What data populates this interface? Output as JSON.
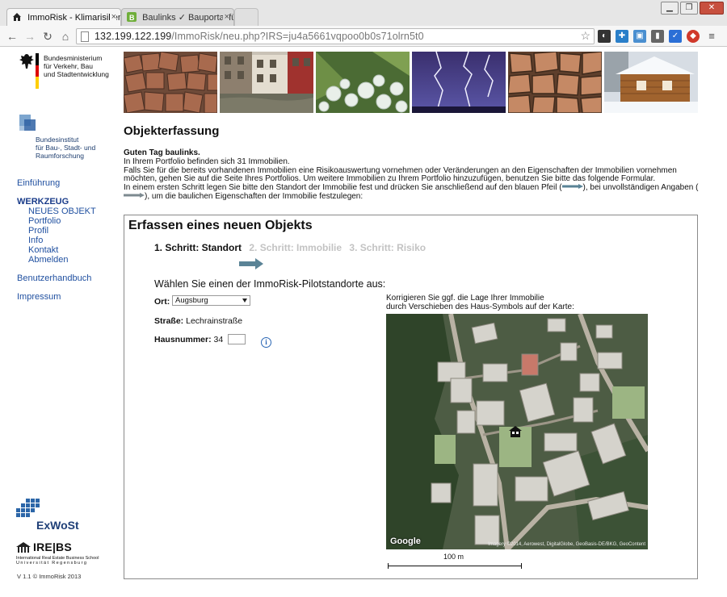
{
  "browser": {
    "tabs": [
      {
        "label": "ImmoRisk - Klimarisiken",
        "close": "×"
      },
      {
        "label": "Baulinks ✓ Bauportal für",
        "close": "×"
      }
    ],
    "url_host": "132.199.122.199",
    "url_path": "/ImmoRisk/neu.php?IRS=ju4a5661vqpoo0b0s71olrn5t0",
    "window_buttons": [
      "▁",
      "❐",
      "✕"
    ]
  },
  "sidebar": {
    "ministry": [
      "Bundesministerium",
      "für Verkehr, Bau",
      "und Stadtentwicklung"
    ],
    "institute": [
      "Bundesinstitut",
      "für Bau-, Stadt- und",
      "Raumforschung"
    ],
    "nav": {
      "einfuehrung": "Einführung",
      "werkzeug": "WERKZEUG",
      "werkzeug_items": [
        "NEUES OBJEKT",
        "Portfolio",
        "Profil",
        "Info",
        "Kontakt",
        "Abmelden"
      ],
      "benutzerhandbuch": "Benutzerhandbuch",
      "impressum": "Impressum"
    },
    "exwost": "ExWoSt",
    "irebs": "IRE|BS",
    "irebs_sub1": "International Real Estate Business School",
    "irebs_sub2": "Universität Regensburg",
    "version": "V 1.1 © ImmoRisk 2013"
  },
  "main": {
    "title": "Objekterfassung",
    "greeting": "Guten Tag baulinks.",
    "intro_lines": [
      "In Ihrem Portfolio befinden sich 31 Immobilien.",
      "Falls Sie für die bereits vorhandenen Immobilien eine Risikoauswertung vornehmen oder Veränderungen an den Eigenschaften der Immobilien vornehmen möchten, gehen Sie auf die Seite Ihres Portfolios. Um weitere Immobilien zu Ihrem Portfolio hinzuzufügen, benutzen Sie bitte das folgende Formular."
    ],
    "intro_step_part1": "In einem ersten Schritt legen Sie bitte den Standort der Immobilie fest und drücken Sie anschließend auf den blauen Pfeil (",
    "intro_step_part2": "), bei unvollständigen Angaben (",
    "intro_step_part3": "), um die baulichen Eigenschaften der Immobilie festzulegen:"
  },
  "form": {
    "title": "Erfassen eines neuen Objekts",
    "steps": [
      "1. Schritt: Standort",
      "2. Schritt: Immobilie",
      "3. Schritt: Risiko"
    ],
    "choose_label": "Wählen Sie einen der ImmoRisk-Pilotstandorte aus:",
    "ort_label": "Ort:",
    "ort_value": "Augsburg",
    "strasse_label": "Straße:",
    "strasse_value": "Lechrainstraße",
    "hausnummer_label": "Hausnummer:",
    "hausnummer_value": "34",
    "info_glyph": "i",
    "map_hint_1": "Korrigieren Sie ggf. die Lage Ihrer Immobilie",
    "map_hint_2": "durch Verschieben des Haus-Symbols auf der Karte:",
    "map_google": "Google",
    "map_copyright": "Imagery ©2014, Aerowest, DigitalGlobe, GeoBasis-DE/BKG, GeoContent",
    "scale_label": "100 m"
  },
  "colors": {
    "nav_link": "#2050a0",
    "arrow": "#5a8396",
    "step_inactive": "#c3c3c3"
  }
}
